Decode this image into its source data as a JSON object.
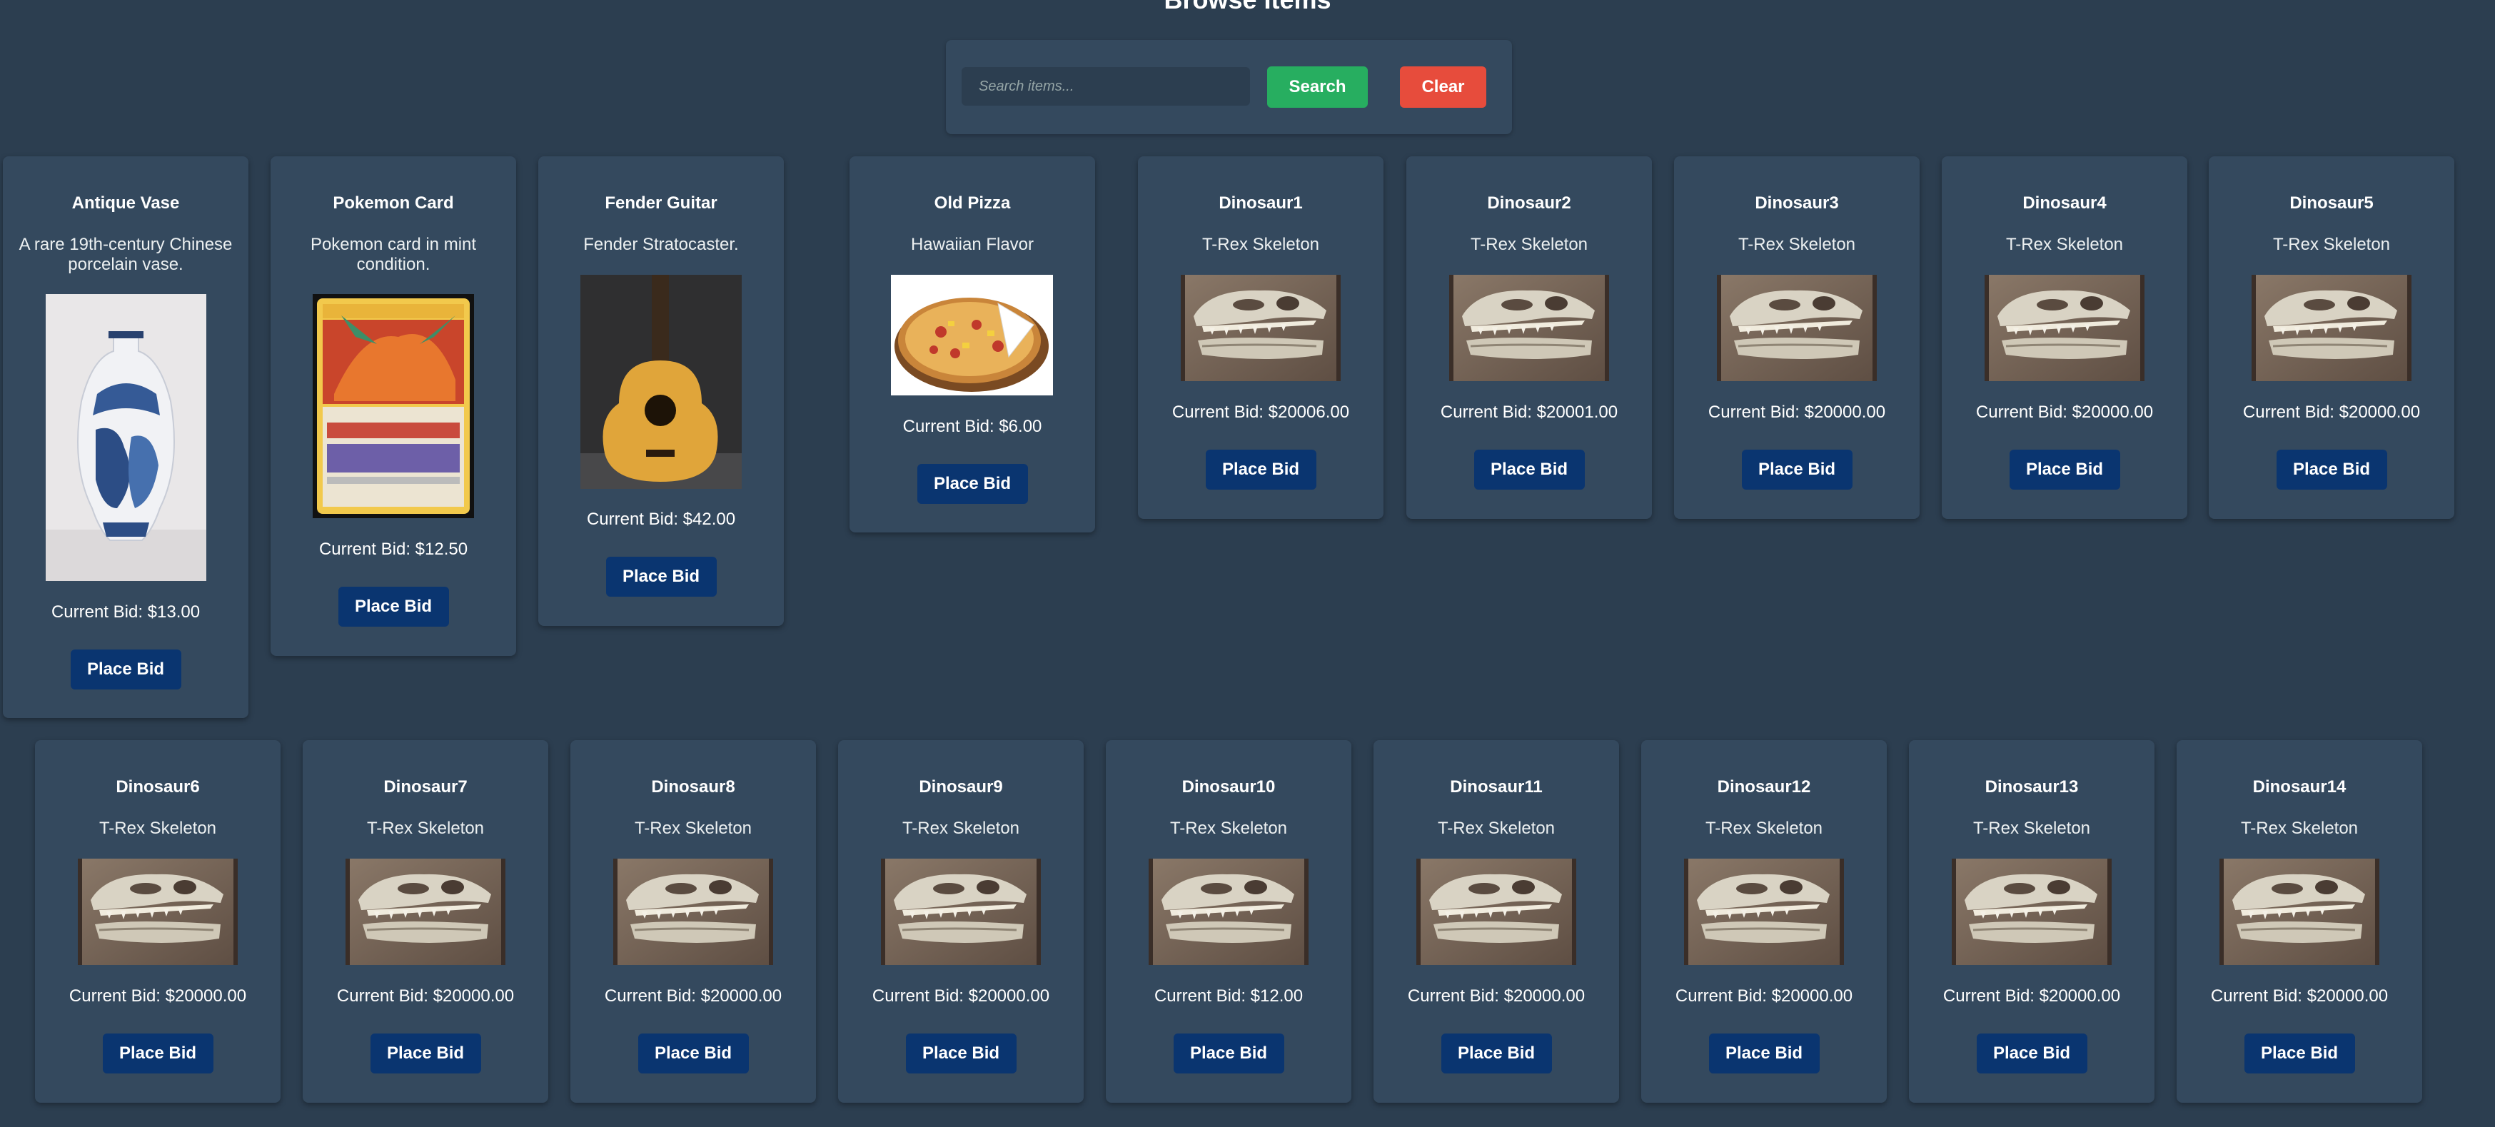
{
  "page": {
    "title": "Browse Items"
  },
  "search": {
    "placeholder": "Search items...",
    "search_label": "Search",
    "clear_label": "Clear"
  },
  "bid_prefix": "Current Bid: ",
  "place_bid_label": "Place Bid",
  "items": [
    {
      "title": "Antique Vase",
      "desc": "A rare 19th-century Chinese porcelain vase.",
      "bid": "Current Bid: $13.00",
      "image": "vase"
    },
    {
      "title": "Pokemon Card",
      "desc": "Pokemon card in mint condition.",
      "bid": "Current Bid: $12.50",
      "image": "card"
    },
    {
      "title": "Fender Guitar",
      "desc": "Fender Stratocaster.",
      "bid": "Current Bid: $42.00",
      "image": "guitar"
    },
    {
      "title": "Old Pizza",
      "desc": "Hawaiian Flavor",
      "bid": "Current Bid: $6.00",
      "image": "pizza"
    },
    {
      "title": "Dinosaur1",
      "desc": "T-Rex Skeleton",
      "bid": "Current Bid: $20006.00",
      "image": "skull"
    },
    {
      "title": "Dinosaur2",
      "desc": "T-Rex Skeleton",
      "bid": "Current Bid: $20001.00",
      "image": "skull"
    },
    {
      "title": "Dinosaur3",
      "desc": "T-Rex Skeleton",
      "bid": "Current Bid: $20000.00",
      "image": "skull"
    },
    {
      "title": "Dinosaur4",
      "desc": "T-Rex Skeleton",
      "bid": "Current Bid: $20000.00",
      "image": "skull"
    },
    {
      "title": "Dinosaur5",
      "desc": "T-Rex Skeleton",
      "bid": "Current Bid: $20000.00",
      "image": "skull"
    },
    {
      "title": "Dinosaur6",
      "desc": "T-Rex Skeleton",
      "bid": "Current Bid: $20000.00",
      "image": "skull"
    },
    {
      "title": "Dinosaur7",
      "desc": "T-Rex Skeleton",
      "bid": "Current Bid: $20000.00",
      "image": "skull"
    },
    {
      "title": "Dinosaur8",
      "desc": "T-Rex Skeleton",
      "bid": "Current Bid: $20000.00",
      "image": "skull"
    },
    {
      "title": "Dinosaur9",
      "desc": "T-Rex Skeleton",
      "bid": "Current Bid: $20000.00",
      "image": "skull"
    },
    {
      "title": "Dinosaur10",
      "desc": "T-Rex Skeleton",
      "bid": "Current Bid: $12.00",
      "image": "skull"
    },
    {
      "title": "Dinosaur11",
      "desc": "T-Rex Skeleton",
      "bid": "Current Bid: $20000.00",
      "image": "skull"
    },
    {
      "title": "Dinosaur12",
      "desc": "T-Rex Skeleton",
      "bid": "Current Bid: $20000.00",
      "image": "skull"
    },
    {
      "title": "Dinosaur13",
      "desc": "T-Rex Skeleton",
      "bid": "Current Bid: $20000.00",
      "image": "skull"
    },
    {
      "title": "Dinosaur14",
      "desc": "T-Rex Skeleton",
      "bid": "Current Bid: $20000.00",
      "image": "skull"
    }
  ],
  "colors": {
    "background": "#2c3e50",
    "card": "#34495e",
    "search_button": "#27ae60",
    "clear_button": "#e74c3c",
    "bid_button": "#0a3570"
  }
}
